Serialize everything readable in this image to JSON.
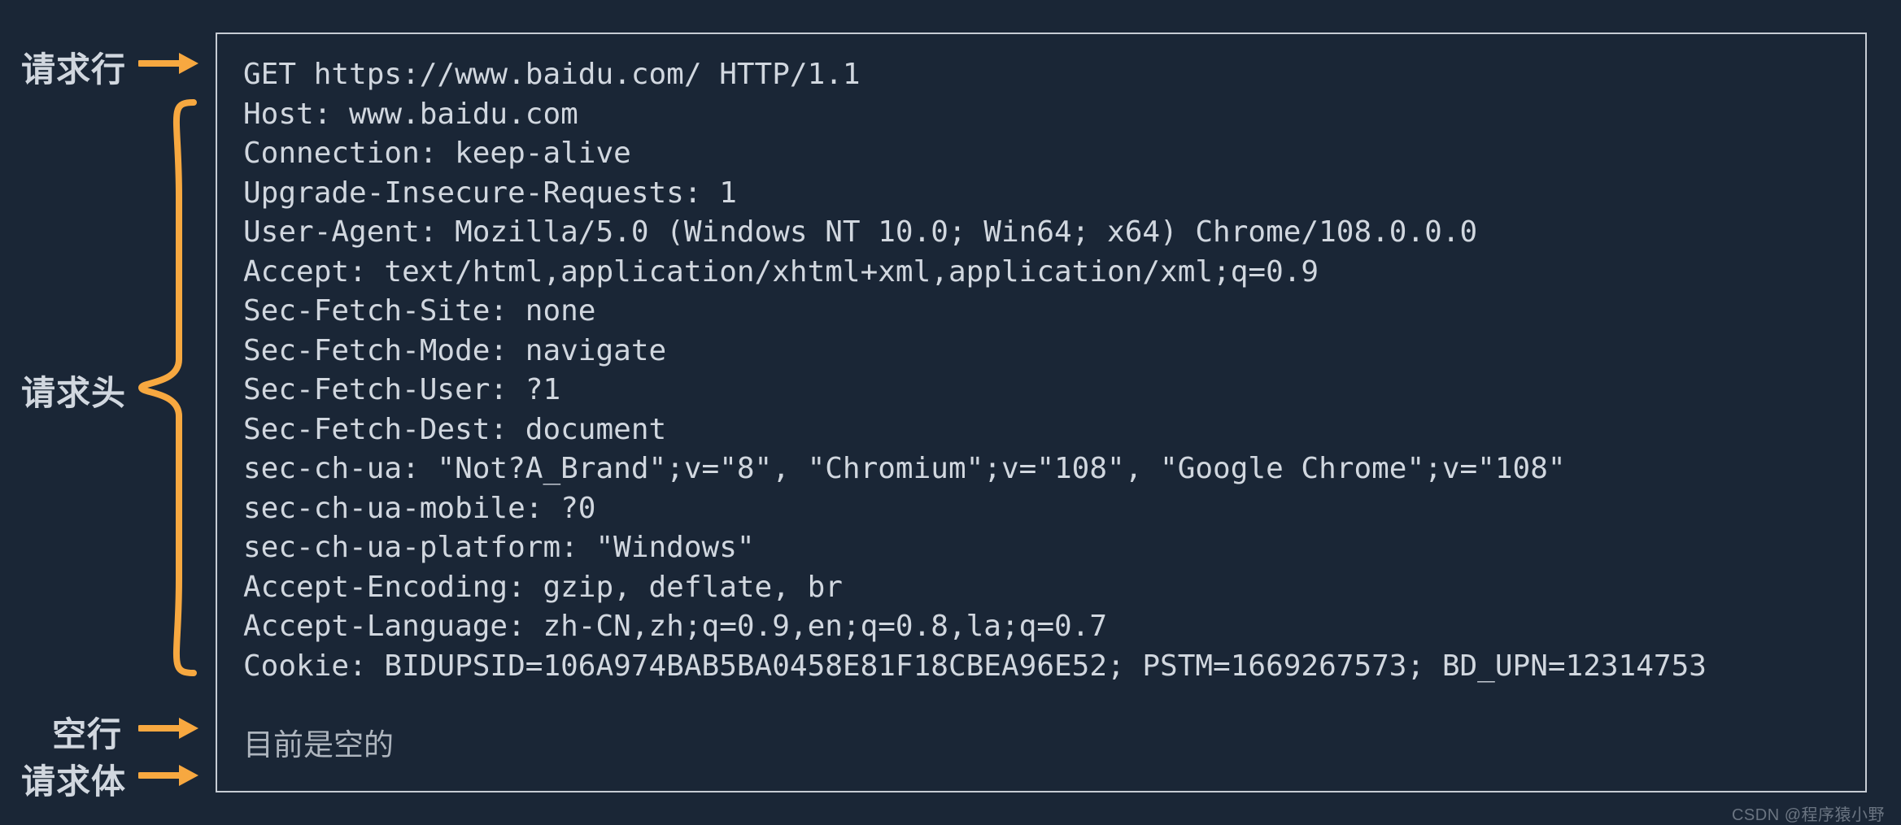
{
  "labels": {
    "request_line": "请求行",
    "request_headers": "请求头",
    "blank_line": "空行",
    "request_body": "请求体"
  },
  "request_line": "GET https://www.baidu.com/ HTTP/1.1",
  "headers": [
    "Host: www.baidu.com",
    "Connection: keep-alive",
    "Upgrade-Insecure-Requests: 1",
    "User-Agent: Mozilla/5.0 (Windows NT 10.0; Win64; x64) Chrome/108.0.0.0",
    "Accept: text/html,application/xhtml+xml,application/xml;q=0.9",
    "Sec-Fetch-Site: none",
    "Sec-Fetch-Mode: navigate",
    "Sec-Fetch-User: ?1",
    "Sec-Fetch-Dest: document",
    "sec-ch-ua: \"Not?A_Brand\";v=\"8\", \"Chromium\";v=\"108\", \"Google Chrome\";v=\"108\"",
    "sec-ch-ua-mobile: ?0",
    "sec-ch-ua-platform: \"Windows\"",
    "Accept-Encoding: gzip, deflate, br",
    "Accept-Language: zh-CN,zh;q=0.9,en;q=0.8,la;q=0.7",
    "Cookie: BIDUPSID=106A974BAB5BA0458E81F18CBEA96E52; PSTM=1669267573; BD_UPN=12314753"
  ],
  "blank_line": "",
  "body": "目前是空的",
  "watermark": "CSDN @程序猿小野",
  "colors": {
    "background": "#1a2636",
    "text": "#d1d7df",
    "arrow": "#f7a840",
    "border": "#c7ccd4"
  }
}
